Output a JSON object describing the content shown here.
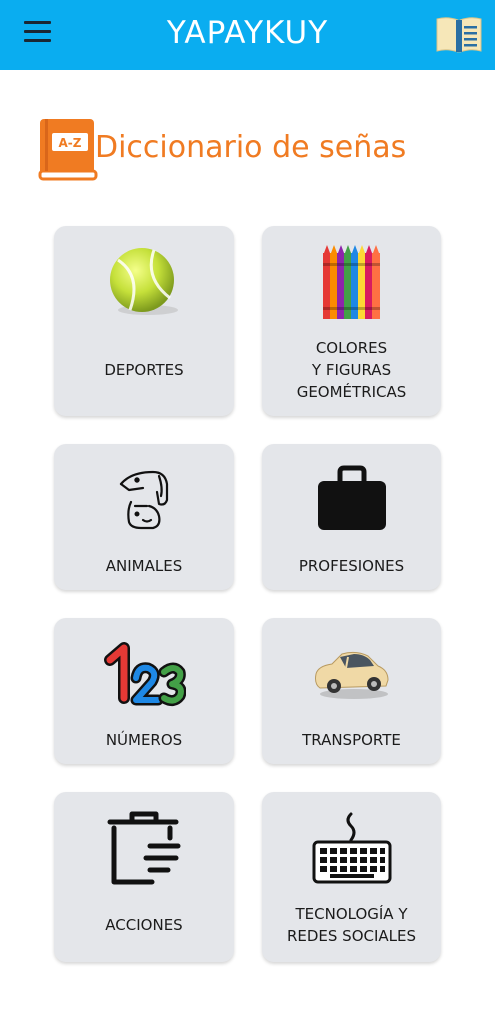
{
  "appbar": {
    "title": "YAPAYKUY",
    "background": "#0aadf0",
    "menu_icon": "hamburger-menu-icon",
    "book_icon": "open-book-icon"
  },
  "dictionary": {
    "title": "Diccionario de señas",
    "icon_label": "A-Z",
    "accent": "#f07b22"
  },
  "categories": [
    {
      "label": "DEPORTES",
      "icon": "tennis-ball-icon"
    },
    {
      "label": "COLORES\nY FIGURAS\nGEOMÉTRICAS",
      "icon": "crayons-icon"
    },
    {
      "label": "ANIMALES",
      "icon": "animals-icon"
    },
    {
      "label": "PROFESIONES",
      "icon": "briefcase-icon"
    },
    {
      "label": "NÚMEROS",
      "icon": "numbers-123-icon"
    },
    {
      "label": "TRANSPORTE",
      "icon": "car-icon"
    },
    {
      "label": "ACCIONES",
      "icon": "clipboard-icon"
    },
    {
      "label": "TECNOLOGÍA Y\nREDES SOCIALES",
      "icon": "keyboard-icon"
    }
  ]
}
